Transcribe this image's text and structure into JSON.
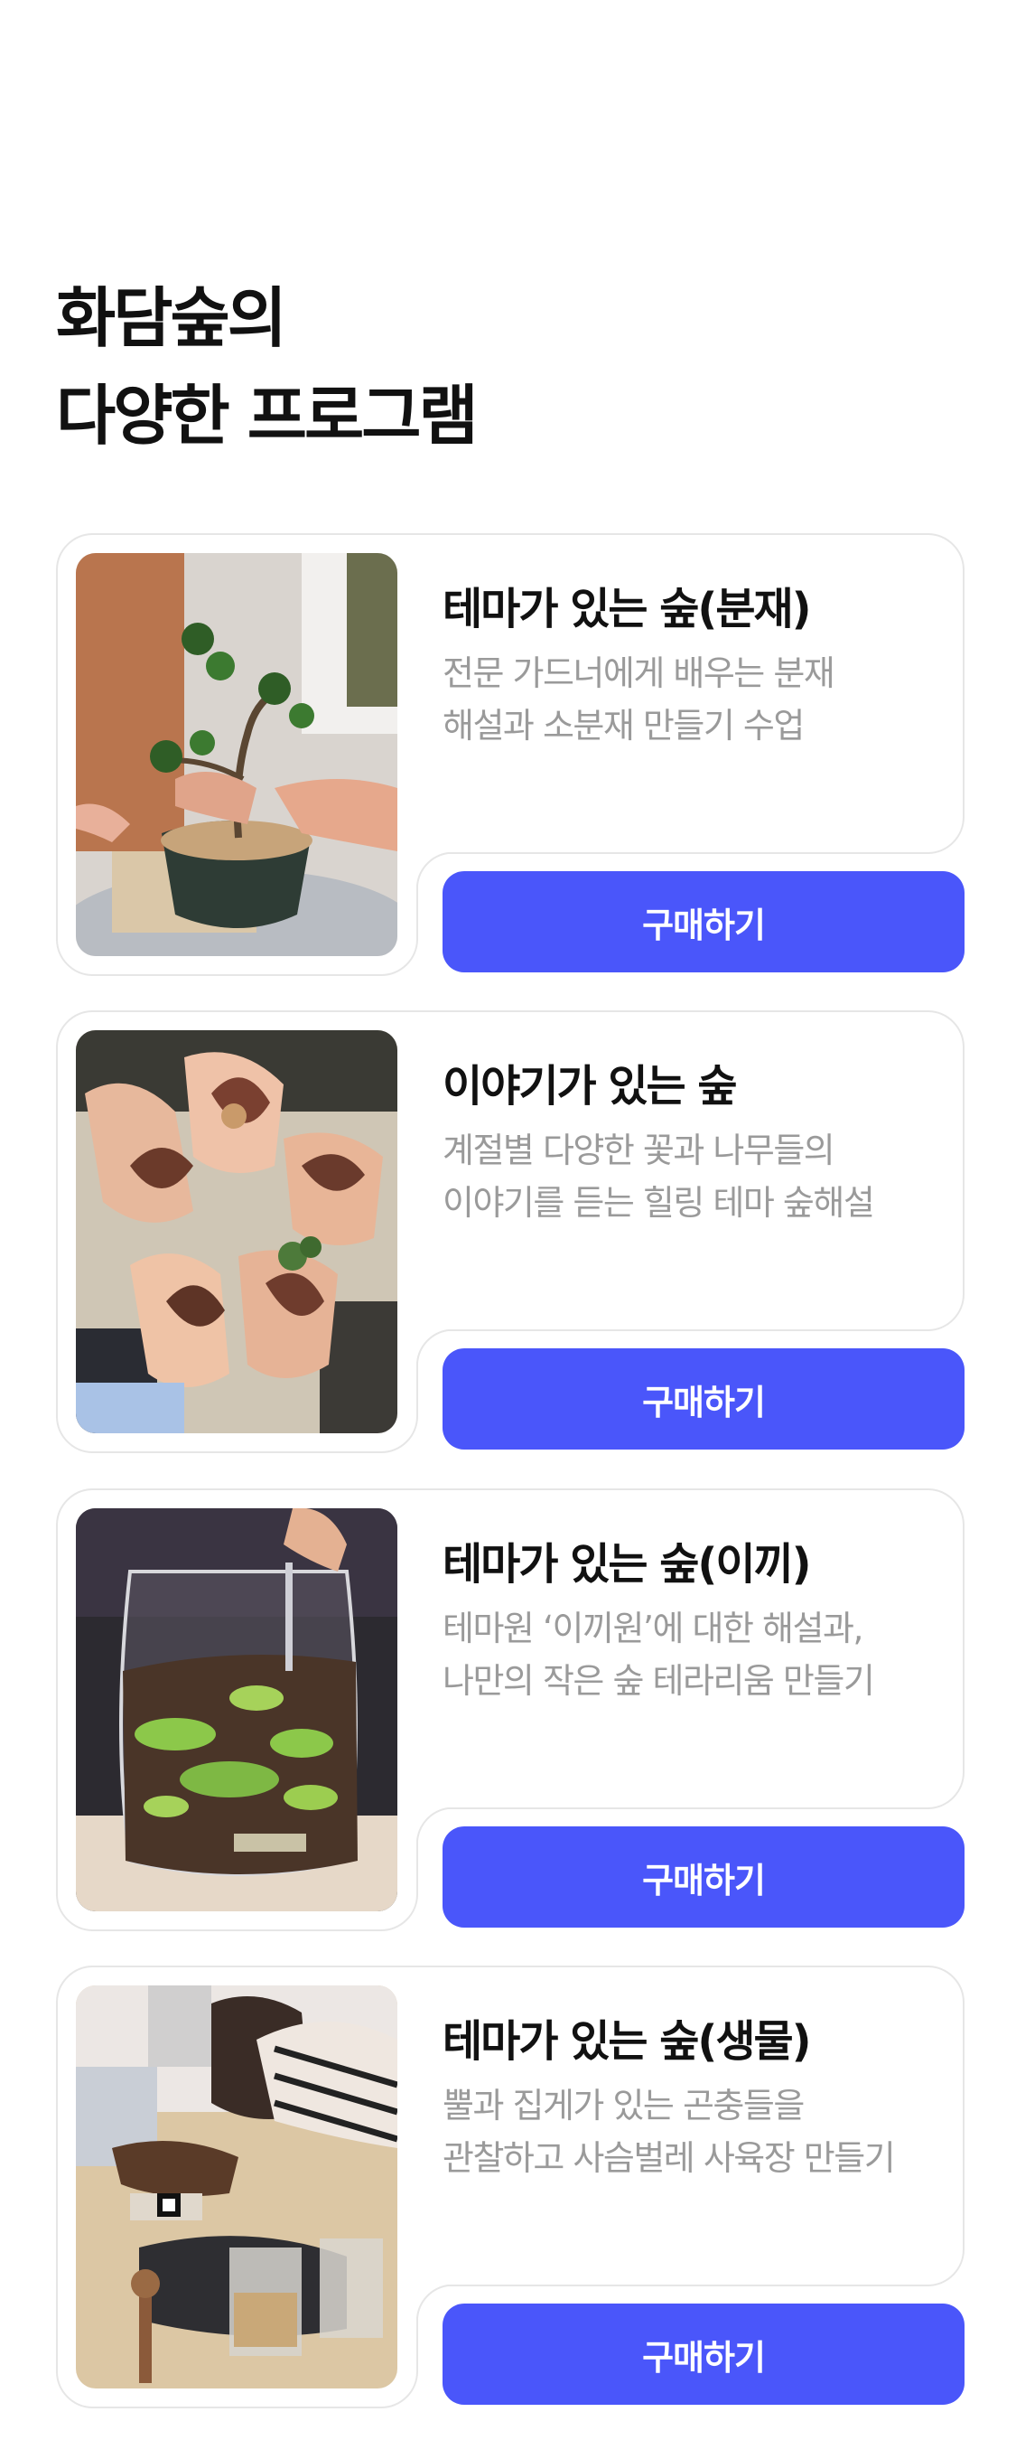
{
  "heading": {
    "line1": "화담숲의",
    "line2": "다양한 프로그램"
  },
  "accent_color": "#4a56fa",
  "programs": [
    {
      "title": "테마가 있는 숲(분재)",
      "desc_line1": "전문 가드너에게 배우는 분재",
      "desc_line2": "해설과 소분재 만들기 수업",
      "button": "구매하기",
      "photo": "bonsai-class-photo"
    },
    {
      "title": "이야기가 있는 숲",
      "desc_line1": "계절별 다양한 꽃과 나무들의",
      "desc_line2": "이야기를 듣는 힐링 테마 숲해설",
      "button": "구매하기",
      "photo": "hands-holding-leaves-photo"
    },
    {
      "title": "테마가 있는 숲(이끼)",
      "desc_line1": "테마원 ‘이끼원’에 대한 해설과,",
      "desc_line2": "나만의 작은 숲 테라리움 만들기",
      "button": "구매하기",
      "photo": "moss-terrarium-photo"
    },
    {
      "title": "테마가 있는 숲(생물)",
      "desc_line1": "뿔과 집게가 있는 곤충들을",
      "desc_line2": "관찰하고 사슴벌레 사육장 만들기",
      "button": "구매하기",
      "photo": "insect-habitat-class-photo"
    }
  ]
}
